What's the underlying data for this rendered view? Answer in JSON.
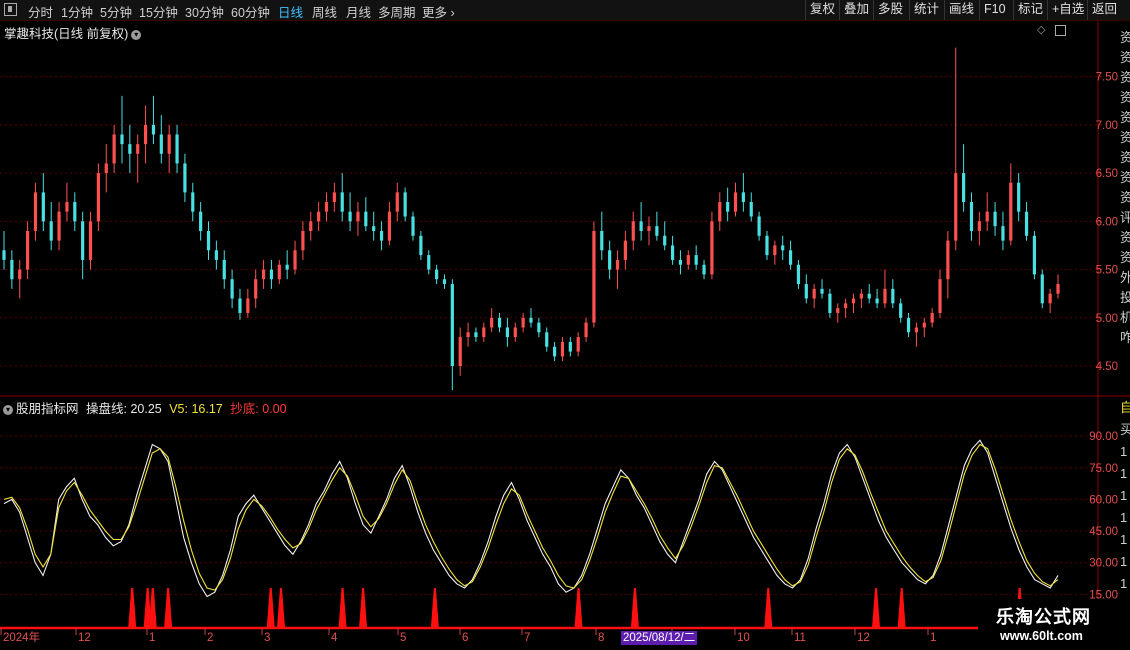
{
  "toolbar": {
    "periods": [
      "分时",
      "1分钟",
      "5分钟",
      "15分钟",
      "30分钟",
      "60分钟",
      "日线",
      "周线",
      "月线",
      "多周期",
      "更多"
    ],
    "active_period": "日线",
    "right_buttons": [
      "复权",
      "叠加",
      "多股",
      "统计",
      "画线",
      "F10",
      "标记",
      "+自选",
      "返回"
    ]
  },
  "main_chart": {
    "title": "掌趣科技(日线 前复权)",
    "y_ticks": [
      "7.50",
      "7.00",
      "6.50",
      "6.00",
      "5.50",
      "5.00",
      "4.50"
    ],
    "side_chars": [
      "资",
      "资",
      "资",
      "资",
      "资",
      "资",
      "资",
      "资",
      "资",
      "评",
      "资",
      "资",
      "外",
      "投",
      "机",
      "咋"
    ]
  },
  "indicator": {
    "name": "股朋指标网",
    "fields": [
      {
        "label": "操盘线: ",
        "value": "20.25",
        "color": "#e8e8e8"
      },
      {
        "label": "V5: ",
        "value": "16.17",
        "color": "#f2e33a"
      },
      {
        "label": "抄底: ",
        "value": "0.00",
        "color": "#ff3a3a"
      }
    ],
    "y_ticks": [
      "90.00",
      "75.00",
      "60.00",
      "45.00",
      "30.00",
      "15.00"
    ],
    "side_chars": [
      "自",
      "买",
      "1",
      "1",
      "1",
      "1",
      "1",
      "1",
      "1"
    ]
  },
  "x_axis": {
    "labels": [
      "2024年",
      "12",
      "1",
      "2",
      "3",
      "4",
      "5",
      "6",
      "7",
      "8",
      "9",
      "10",
      "11",
      "12",
      "1"
    ],
    "cursor_date": "2025/08/12/二"
  },
  "watermark": {
    "text": "乐淘公式网",
    "url": "www.60lt.com"
  },
  "colors": {
    "up": "#ff5050",
    "down": "#48e0e0",
    "line1": "#f0f0f0",
    "line2": "#f2e33a",
    "signal": "#ff1010",
    "grid": "#5a0000"
  },
  "chart_data": {
    "type": "candlestick",
    "title": "掌趣科技(日线 前复权)",
    "ylim": [
      4.2,
      7.9
    ],
    "candles_ohlc": [
      [
        5.7,
        5.9,
        5.5,
        5.6
      ],
      [
        5.6,
        5.7,
        5.3,
        5.4
      ],
      [
        5.4,
        5.6,
        5.2,
        5.5
      ],
      [
        5.5,
        6.0,
        5.4,
        5.9
      ],
      [
        5.9,
        6.4,
        5.8,
        6.3
      ],
      [
        6.3,
        6.5,
        5.9,
        6.0
      ],
      [
        6.0,
        6.2,
        5.7,
        5.8
      ],
      [
        5.8,
        6.2,
        5.7,
        6.1
      ],
      [
        6.1,
        6.4,
        6.0,
        6.2
      ],
      [
        6.2,
        6.3,
        5.9,
        6.0
      ],
      [
        6.0,
        6.1,
        5.4,
        5.6
      ],
      [
        5.6,
        6.1,
        5.5,
        6.0
      ],
      [
        6.0,
        6.6,
        5.9,
        6.5
      ],
      [
        6.5,
        6.8,
        6.3,
        6.6
      ],
      [
        6.6,
        7.0,
        6.5,
        6.9
      ],
      [
        6.9,
        7.3,
        6.6,
        6.8
      ],
      [
        6.8,
        7.0,
        6.5,
        6.7
      ],
      [
        6.7,
        6.9,
        6.4,
        6.8
      ],
      [
        6.8,
        7.2,
        6.6,
        7.0
      ],
      [
        7.0,
        7.3,
        6.8,
        6.9
      ],
      [
        6.9,
        7.1,
        6.6,
        6.7
      ],
      [
        6.7,
        7.0,
        6.5,
        6.9
      ],
      [
        6.9,
        7.0,
        6.5,
        6.6
      ],
      [
        6.6,
        6.7,
        6.2,
        6.3
      ],
      [
        6.3,
        6.4,
        6.0,
        6.1
      ],
      [
        6.1,
        6.2,
        5.8,
        5.9
      ],
      [
        5.9,
        6.0,
        5.6,
        5.7
      ],
      [
        5.7,
        5.8,
        5.5,
        5.6
      ],
      [
        5.6,
        5.7,
        5.3,
        5.4
      ],
      [
        5.4,
        5.5,
        5.1,
        5.2
      ],
      [
        5.2,
        5.3,
        4.98,
        5.05
      ],
      [
        5.05,
        5.3,
        5.0,
        5.2
      ],
      [
        5.2,
        5.5,
        5.1,
        5.4
      ],
      [
        5.4,
        5.6,
        5.3,
        5.5
      ],
      [
        5.5,
        5.6,
        5.3,
        5.4
      ],
      [
        5.4,
        5.6,
        5.35,
        5.55
      ],
      [
        5.55,
        5.7,
        5.4,
        5.5
      ],
      [
        5.5,
        5.8,
        5.45,
        5.7
      ],
      [
        5.7,
        6.0,
        5.6,
        5.9
      ],
      [
        5.9,
        6.1,
        5.8,
        6.0
      ],
      [
        6.0,
        6.2,
        5.9,
        6.1
      ],
      [
        6.1,
        6.3,
        6.0,
        6.2
      ],
      [
        6.2,
        6.4,
        6.1,
        6.3
      ],
      [
        6.3,
        6.5,
        6.0,
        6.1
      ],
      [
        6.1,
        6.3,
        5.9,
        6.0
      ],
      [
        6.0,
        6.2,
        5.85,
        6.1
      ],
      [
        6.1,
        6.25,
        5.9,
        5.95
      ],
      [
        5.95,
        6.1,
        5.8,
        5.9
      ],
      [
        5.9,
        6.0,
        5.7,
        5.8
      ],
      [
        5.8,
        6.2,
        5.75,
        6.1
      ],
      [
        6.1,
        6.4,
        6.0,
        6.3
      ],
      [
        6.3,
        6.35,
        6.0,
        6.05
      ],
      [
        6.05,
        6.1,
        5.8,
        5.85
      ],
      [
        5.85,
        5.9,
        5.6,
        5.65
      ],
      [
        5.65,
        5.7,
        5.45,
        5.5
      ],
      [
        5.5,
        5.55,
        5.35,
        5.4
      ],
      [
        5.4,
        5.45,
        5.3,
        5.35
      ],
      [
        5.35,
        5.4,
        4.25,
        4.5
      ],
      [
        4.5,
        4.9,
        4.4,
        4.8
      ],
      [
        4.8,
        4.95,
        4.7,
        4.85
      ],
      [
        4.85,
        4.9,
        4.75,
        4.8
      ],
      [
        4.8,
        4.95,
        4.75,
        4.9
      ],
      [
        4.9,
        5.1,
        4.85,
        5.0
      ],
      [
        5.0,
        5.05,
        4.85,
        4.9
      ],
      [
        4.9,
        5.0,
        4.7,
        4.8
      ],
      [
        4.8,
        4.95,
        4.75,
        4.9
      ],
      [
        4.9,
        5.05,
        4.85,
        5.0
      ],
      [
        5.0,
        5.1,
        4.9,
        4.95
      ],
      [
        4.95,
        5.0,
        4.8,
        4.85
      ],
      [
        4.85,
        4.9,
        4.65,
        4.7
      ],
      [
        4.7,
        4.75,
        4.55,
        4.6
      ],
      [
        4.6,
        4.8,
        4.55,
        4.75
      ],
      [
        4.75,
        4.8,
        4.6,
        4.65
      ],
      [
        4.65,
        4.85,
        4.6,
        4.8
      ],
      [
        4.8,
        5.0,
        4.75,
        4.95
      ],
      [
        4.95,
        6.0,
        4.9,
        5.9
      ],
      [
        5.9,
        6.1,
        5.6,
        5.7
      ],
      [
        5.7,
        5.8,
        5.4,
        5.5
      ],
      [
        5.5,
        5.7,
        5.3,
        5.6
      ],
      [
        5.6,
        5.9,
        5.5,
        5.8
      ],
      [
        5.8,
        6.1,
        5.7,
        6.0
      ],
      [
        6.0,
        6.2,
        5.8,
        5.9
      ],
      [
        5.9,
        6.05,
        5.75,
        5.95
      ],
      [
        5.95,
        6.1,
        5.8,
        5.85
      ],
      [
        5.85,
        6.0,
        5.7,
        5.75
      ],
      [
        5.75,
        5.85,
        5.55,
        5.6
      ],
      [
        5.6,
        5.7,
        5.45,
        5.55
      ],
      [
        5.55,
        5.7,
        5.5,
        5.65
      ],
      [
        5.65,
        5.75,
        5.5,
        5.55
      ],
      [
        5.55,
        5.6,
        5.4,
        5.45
      ],
      [
        5.45,
        6.1,
        5.4,
        6.0
      ],
      [
        6.0,
        6.3,
        5.9,
        6.2
      ],
      [
        6.2,
        6.35,
        6.0,
        6.1
      ],
      [
        6.1,
        6.4,
        6.05,
        6.3
      ],
      [
        6.3,
        6.5,
        6.1,
        6.2
      ],
      [
        6.2,
        6.3,
        6.0,
        6.05
      ],
      [
        6.05,
        6.1,
        5.8,
        5.85
      ],
      [
        5.85,
        5.9,
        5.6,
        5.65
      ],
      [
        5.65,
        5.8,
        5.55,
        5.75
      ],
      [
        5.75,
        5.85,
        5.6,
        5.7
      ],
      [
        5.7,
        5.8,
        5.5,
        5.55
      ],
      [
        5.55,
        5.6,
        5.3,
        5.35
      ],
      [
        5.35,
        5.45,
        5.15,
        5.2
      ],
      [
        5.2,
        5.35,
        5.1,
        5.3
      ],
      [
        5.3,
        5.4,
        5.2,
        5.25
      ],
      [
        5.25,
        5.3,
        5.0,
        5.05
      ],
      [
        5.05,
        5.15,
        4.95,
        5.1
      ],
      [
        5.1,
        5.2,
        5.0,
        5.15
      ],
      [
        5.15,
        5.25,
        5.05,
        5.2
      ],
      [
        5.2,
        5.3,
        5.1,
        5.25
      ],
      [
        5.25,
        5.35,
        5.15,
        5.2
      ],
      [
        5.2,
        5.3,
        5.1,
        5.15
      ],
      [
        5.15,
        5.5,
        5.1,
        5.3
      ],
      [
        5.3,
        5.4,
        5.1,
        5.15
      ],
      [
        5.15,
        5.2,
        4.95,
        5.0
      ],
      [
        5.0,
        5.05,
        4.8,
        4.85
      ],
      [
        4.85,
        4.95,
        4.7,
        4.9
      ],
      [
        4.9,
        5.0,
        4.8,
        4.95
      ],
      [
        4.95,
        5.1,
        4.9,
        5.05
      ],
      [
        5.05,
        5.5,
        5.0,
        5.4
      ],
      [
        5.4,
        5.9,
        5.2,
        5.8
      ],
      [
        5.8,
        7.8,
        5.7,
        6.5
      ],
      [
        6.5,
        6.8,
        6.1,
        6.2
      ],
      [
        6.2,
        6.3,
        5.8,
        5.9
      ],
      [
        5.9,
        6.1,
        5.75,
        6.0
      ],
      [
        6.0,
        6.3,
        5.9,
        6.1
      ],
      [
        6.1,
        6.2,
        5.85,
        5.95
      ],
      [
        5.95,
        6.1,
        5.7,
        5.8
      ],
      [
        5.8,
        6.6,
        5.75,
        6.4
      ],
      [
        6.4,
        6.5,
        6.0,
        6.1
      ],
      [
        6.1,
        6.2,
        5.8,
        5.85
      ],
      [
        5.85,
        5.9,
        5.4,
        5.45
      ],
      [
        5.45,
        5.5,
        5.1,
        5.15
      ],
      [
        5.15,
        5.3,
        5.05,
        5.25
      ],
      [
        5.25,
        5.45,
        5.2,
        5.35
      ]
    ],
    "indicator_series": [
      {
        "name": "操盘线",
        "values": [
          58,
          60,
          54,
          42,
          30,
          24,
          34,
          60,
          66,
          70,
          60,
          52,
          48,
          42,
          38,
          40,
          48,
          62,
          74,
          86,
          84,
          78,
          60,
          42,
          30,
          20,
          14,
          16,
          24,
          36,
          52,
          58,
          62,
          56,
          50,
          44,
          38,
          34,
          40,
          48,
          58,
          64,
          72,
          78,
          70,
          58,
          48,
          44,
          52,
          60,
          70,
          76,
          66,
          54,
          44,
          36,
          30,
          24,
          20,
          18,
          22,
          30,
          40,
          52,
          62,
          68,
          60,
          50,
          42,
          34,
          28,
          20,
          16,
          18,
          24,
          34,
          46,
          58,
          66,
          74,
          70,
          62,
          56,
          48,
          40,
          34,
          30,
          40,
          50,
          60,
          72,
          78,
          74,
          66,
          58,
          50,
          42,
          36,
          30,
          24,
          20,
          18,
          22,
          32,
          46,
          58,
          72,
          82,
          86,
          80,
          70,
          60,
          50,
          42,
          36,
          30,
          26,
          22,
          20,
          24,
          34,
          48,
          62,
          76,
          84,
          88,
          82,
          70,
          58,
          46,
          36,
          28,
          22,
          20,
          18,
          24
        ]
      },
      {
        "name": "V5",
        "values": [
          60,
          61,
          56,
          46,
          34,
          28,
          34,
          56,
          64,
          68,
          62,
          55,
          50,
          45,
          41,
          41,
          47,
          58,
          70,
          82,
          84,
          80,
          66,
          50,
          36,
          25,
          18,
          17,
          22,
          32,
          46,
          55,
          60,
          57,
          52,
          46,
          41,
          37,
          39,
          46,
          55,
          62,
          69,
          75,
          71,
          62,
          52,
          47,
          51,
          58,
          67,
          74,
          69,
          58,
          48,
          40,
          33,
          27,
          22,
          19,
          21,
          28,
          37,
          48,
          58,
          65,
          62,
          53,
          45,
          37,
          31,
          24,
          19,
          18,
          22,
          31,
          42,
          54,
          63,
          71,
          70,
          64,
          58,
          51,
          43,
          37,
          32,
          38,
          47,
          57,
          68,
          76,
          75,
          68,
          61,
          53,
          45,
          39,
          33,
          27,
          22,
          19,
          21,
          29,
          42,
          54,
          68,
          79,
          84,
          81,
          73,
          63,
          54,
          45,
          39,
          33,
          28,
          24,
          21,
          23,
          31,
          44,
          58,
          72,
          81,
          86,
          84,
          74,
          62,
          50,
          40,
          31,
          25,
          21,
          19,
          22
        ]
      }
    ],
    "signal_positions": [
      25,
      28,
      29,
      32,
      52,
      54,
      66,
      70,
      84,
      112,
      123,
      149,
      170,
      175,
      198
    ]
  }
}
